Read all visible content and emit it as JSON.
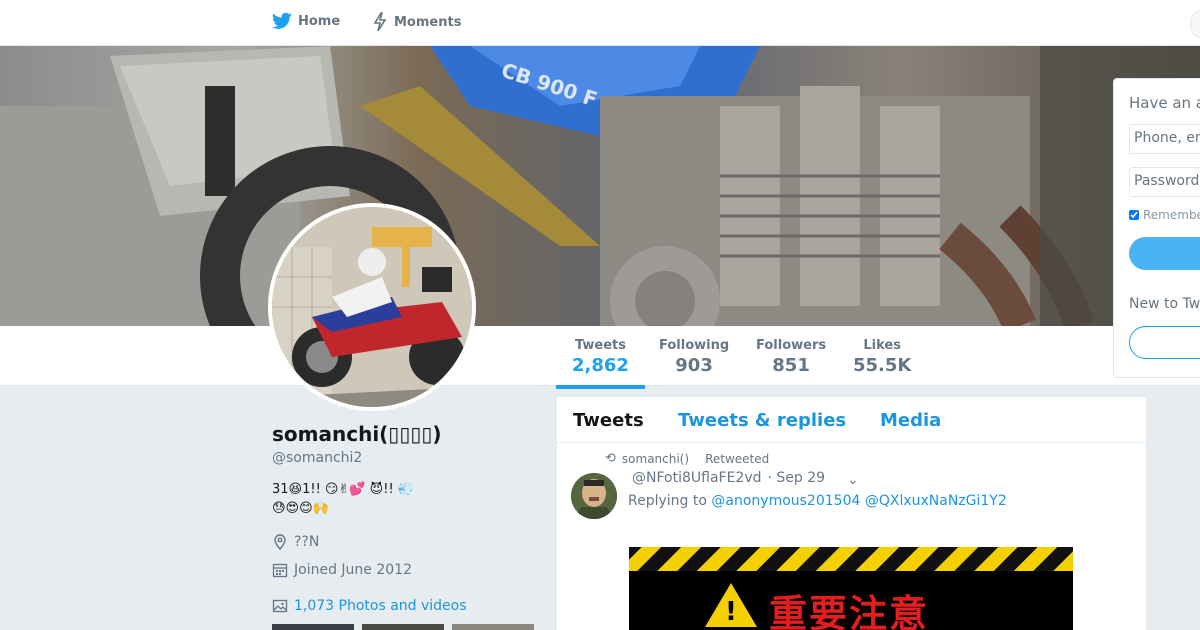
{
  "nav": {
    "home_label": "Home",
    "moments_label": "Moments",
    "home_icon": "twitter-bird-icon",
    "moments_icon": "lightning-icon"
  },
  "banner": {
    "badge_text": "CB 900 F"
  },
  "stats": [
    {
      "label": "Tweets",
      "value": "2,862"
    },
    {
      "label": "Following",
      "value": "903"
    },
    {
      "label": "Followers",
      "value": "851"
    },
    {
      "label": "Likes",
      "value": "55.5K"
    }
  ],
  "profile": {
    "name": "somanchi(▯▯▯▯)",
    "handle": "@somanchi2",
    "bio_line1": "31😆1!!        😏✌💕       😈!!   💨",
    "bio_line2": "😓😍😊🙌",
    "location": "??N",
    "joined": "Joined June 2012",
    "photos_link": "1,073 Photos and videos"
  },
  "timeline": {
    "tabs": [
      "Tweets",
      "Tweets & replies",
      "Media"
    ],
    "tweet": {
      "retweeted_by": "somanchi()",
      "retweeted_label": "Retweeted",
      "author": "@NFoti8UflaFE2vd",
      "date": "· Sep 29",
      "replying_prefix": "Replying to",
      "replying_to": "@anonymous201504 @QXlxuxNaNzGi1Y2",
      "media_text": "重要注意"
    }
  },
  "login": {
    "title": "Have an a",
    "phone_placeholder": "Phone, em",
    "password_placeholder": "Password",
    "remember_label": "Remember",
    "new_label": "New to Tw"
  },
  "colors": {
    "accent": "#1da1f2",
    "link": "#1b95e0",
    "background": "#e6ecf0"
  }
}
